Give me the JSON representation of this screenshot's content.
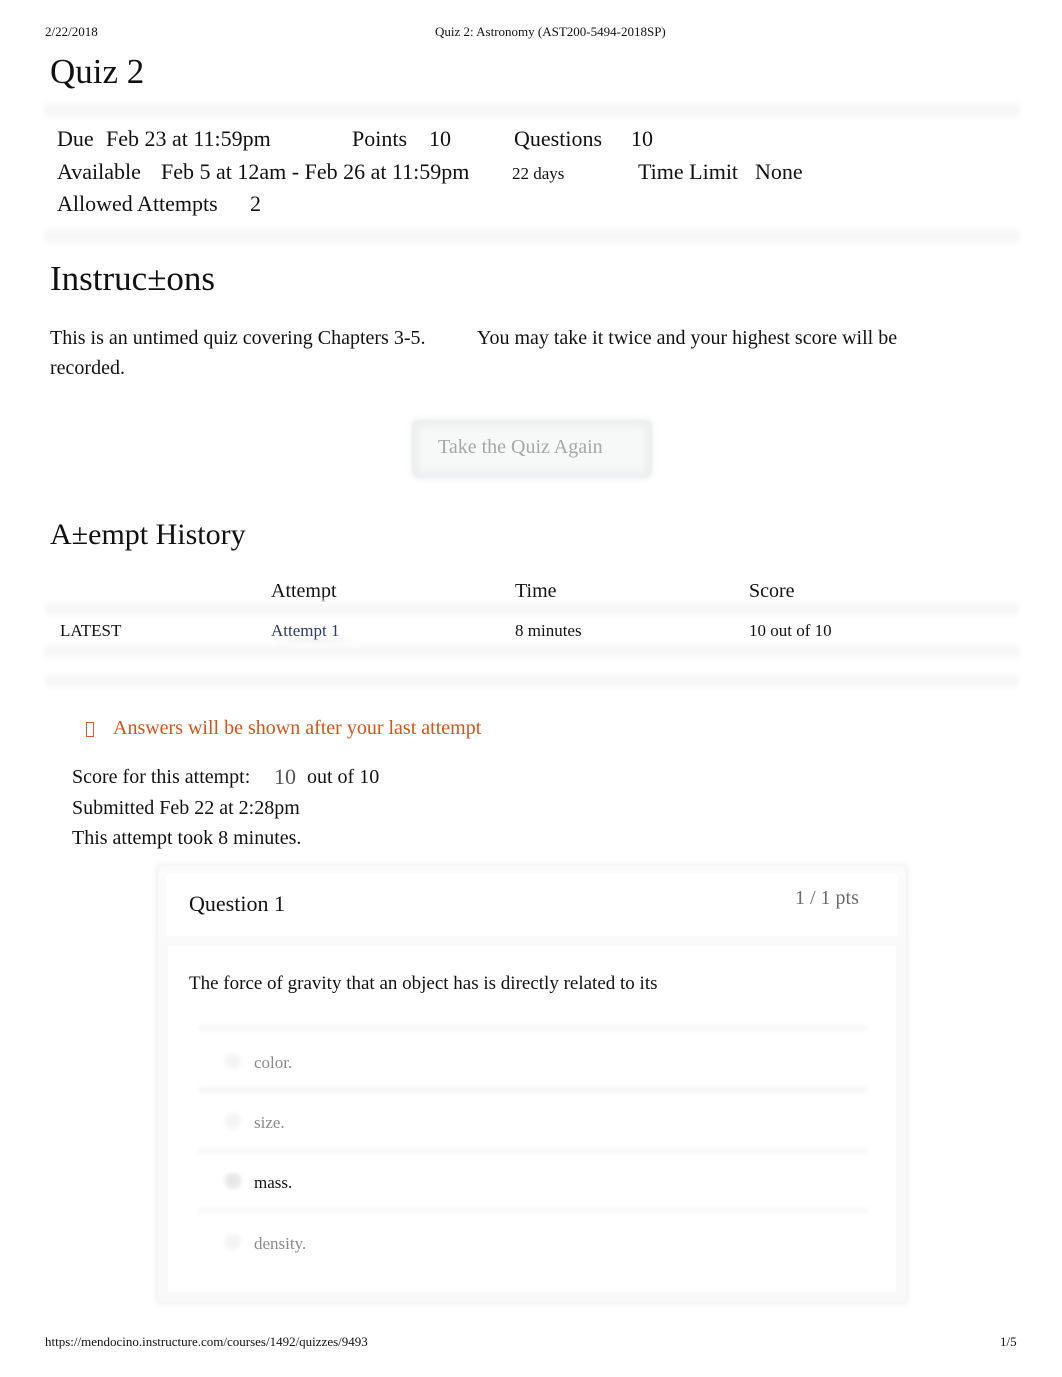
{
  "print_header": {
    "date": "2/22/2018",
    "title": "Quiz 2: Astronomy (AST200-5494-2018SP)"
  },
  "quiz": {
    "title": "Quiz 2",
    "details": {
      "due_label": "Due",
      "due_value": "Feb 23 at 11:59pm",
      "points_label": "Points",
      "points_value": "10",
      "questions_label": "Questions",
      "questions_value": "10",
      "available_label": "Available",
      "available_value": "Feb 5 at 12am - Feb 26 at 11:59pm",
      "available_duration": "22 days",
      "time_limit_label": "Time Limit",
      "time_limit_value": "None",
      "allowed_attempts_label": "Allowed Attempts",
      "allowed_attempts_value": "2"
    }
  },
  "instructions": {
    "heading": "Instruc±ons",
    "line1_part1": "This is an untimed quiz covering Chapters 3-5.",
    "line1_part2": "You may take it twice and your highest score will be",
    "line2": "recorded."
  },
  "take_quiz_button": {
    "label": "Take the Quiz Again"
  },
  "attempt_history": {
    "heading": "A±empt History",
    "columns": [
      "",
      "Attempt",
      "Time",
      "Score"
    ],
    "rows": [
      {
        "tag": "LATEST",
        "attempt": "Attempt 1",
        "time": "8 minutes",
        "score": "10 out of 10"
      }
    ]
  },
  "notice": {
    "icon": "info-icon",
    "text": "Answers will be shown after your last attempt",
    "color": "#d2541e"
  },
  "attempt_summary": {
    "score_label": "Score for this attempt:",
    "score_value": "10",
    "score_out_of": "out of 10",
    "submitted": "Submitted Feb 22 at 2:28pm",
    "duration": "This attempt took 8 minutes."
  },
  "question": {
    "title": "Question 1",
    "points": "1 / 1 pts",
    "text": "The force of gravity that an object has is directly related to its",
    "answers": [
      {
        "label": "color.",
        "selected": false
      },
      {
        "label": "size.",
        "selected": false
      },
      {
        "label": "mass.",
        "selected": true
      },
      {
        "label": "density.",
        "selected": false
      }
    ]
  },
  "print_footer": {
    "url": "https://mendocino.instructure.com/courses/1492/quizzes/9493",
    "page": "1/5"
  }
}
